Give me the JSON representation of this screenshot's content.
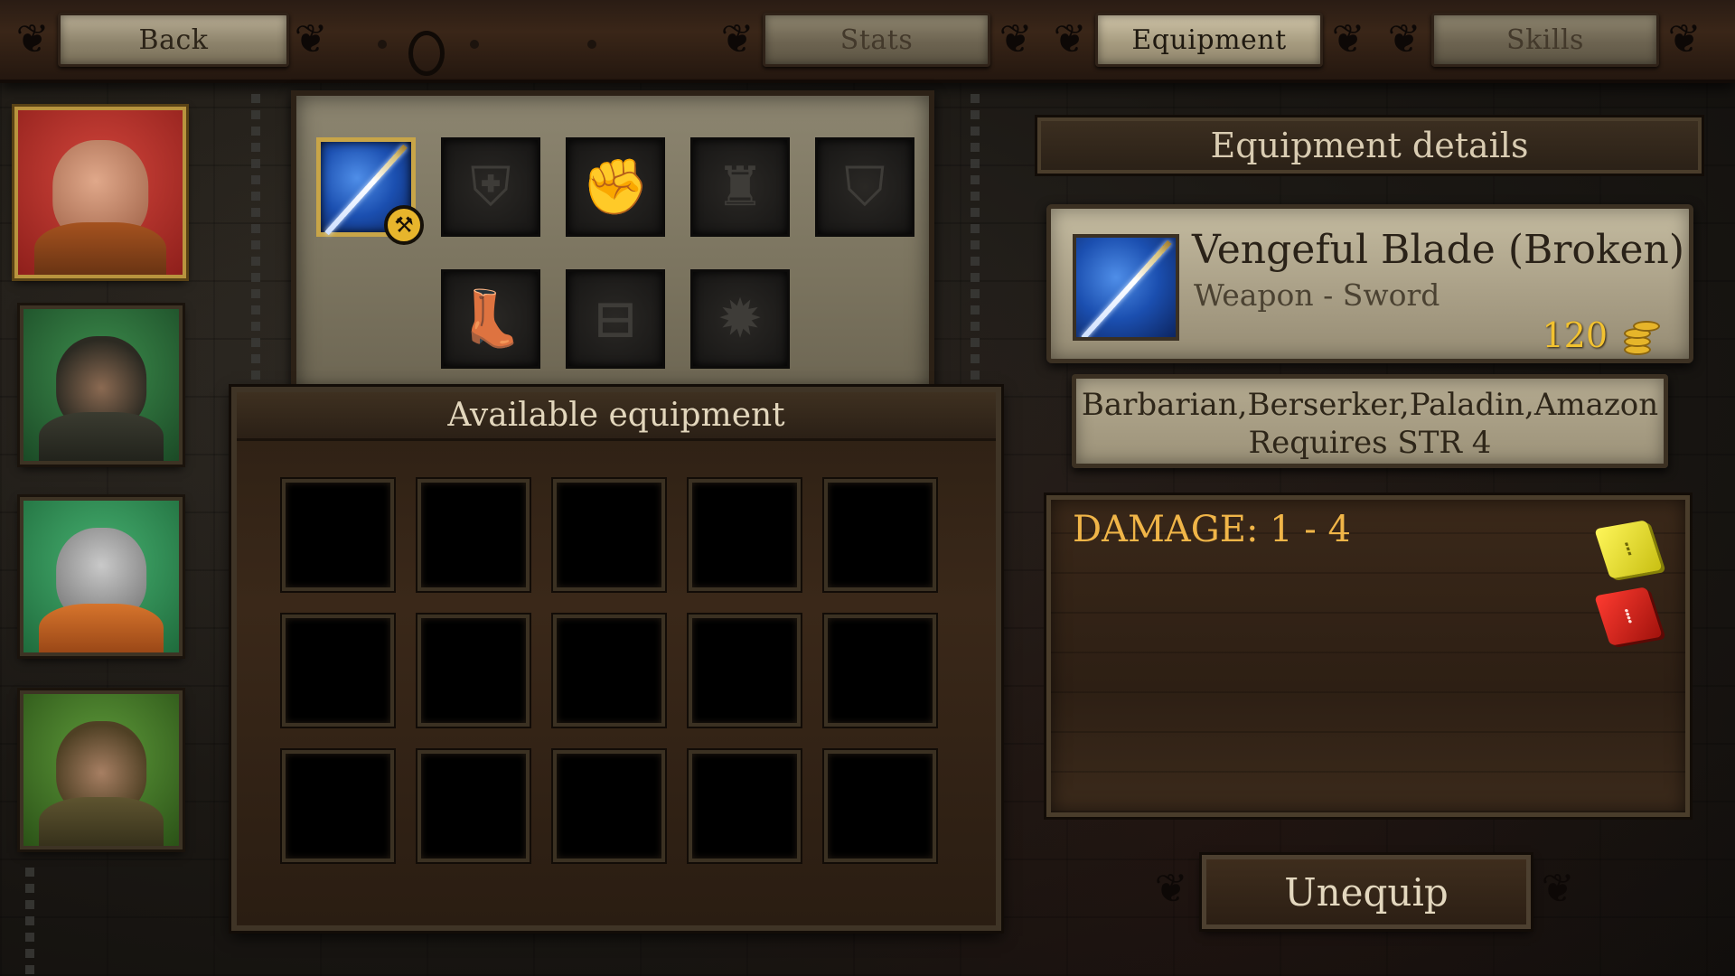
{
  "topbar": {
    "back_label": "Back",
    "tabs": [
      {
        "label": "Stats",
        "state": "inactive"
      },
      {
        "label": "Equipment",
        "state": "active"
      },
      {
        "label": "Skills",
        "state": "inactive"
      }
    ]
  },
  "party": [
    {
      "name": "portrait-scarred-warrior",
      "bg": "#b7312c",
      "selected": true
    },
    {
      "name": "portrait-hooded-ranger",
      "bg": "#2d6f3e",
      "selected": false
    },
    {
      "name": "portrait-dwarf-helmet",
      "bg": "#2f8a55",
      "selected": false
    },
    {
      "name": "portrait-hooded-rogue",
      "bg": "#3d7a2e",
      "selected": false
    }
  ],
  "equipped_slots": [
    {
      "slot": "weapon",
      "icon": "sword-icon",
      "filled": true,
      "badge": "repair-hammer-icon"
    },
    {
      "slot": "armor",
      "icon": "chest-armor-icon",
      "filled": false
    },
    {
      "slot": "gloves",
      "icon": "gauntlet-icon",
      "filled": false
    },
    {
      "slot": "helmet",
      "icon": "horned-helmet-icon",
      "filled": false
    },
    {
      "slot": "shield",
      "icon": "shield-icon",
      "filled": false
    },
    {
      "slot": "boots",
      "icon": "boot-icon",
      "filled": false
    },
    {
      "slot": "belt",
      "icon": "belt-icon",
      "filled": false
    },
    {
      "slot": "amulet",
      "icon": "amulet-icon",
      "filled": false
    }
  ],
  "available": {
    "title": "Available equipment",
    "rows": 3,
    "cols": 5
  },
  "details": {
    "title": "Equipment details",
    "item_name": "Vengeful Blade (Broken)",
    "item_type": "Weapon - Sword",
    "price": "120",
    "classes": "Barbarian,Berserker,Paladin,Amazon",
    "requirement": "Requires STR 4",
    "damage": "DAMAGE: 1 - 4"
  },
  "unequip_label": "Unequip",
  "colors": {
    "accent_gold": "#c8a548",
    "damage_orange": "#f0b548",
    "price_gold": "#f2c230"
  }
}
